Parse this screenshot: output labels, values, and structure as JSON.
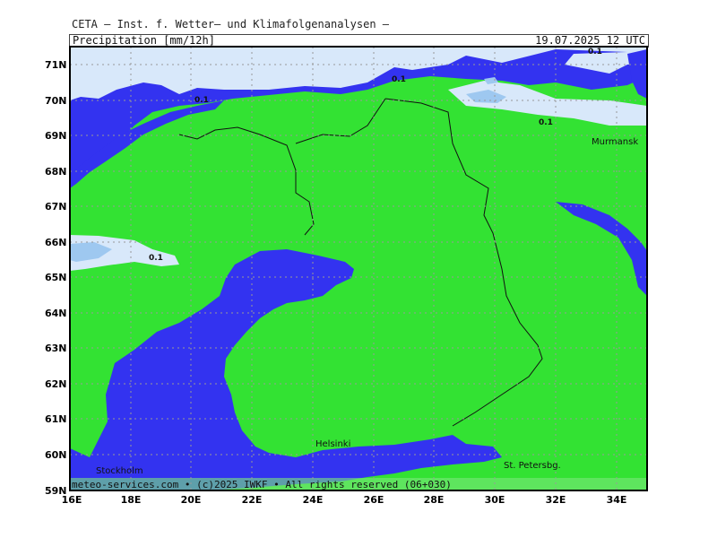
{
  "header": {
    "source": "CETA — Inst. f. Wetter— und Klimafolgenanalysen —",
    "variable": "Precipitation [mm/12h]",
    "timestamp": "19.07.2025 12 UTC"
  },
  "footer": {
    "copyright": "meteo-services.com • (c)2025 IWKF • All rights reserved (06+030)"
  },
  "map": {
    "colors": {
      "land_no_precip": "#33e233",
      "sea": "#3333f0",
      "precip_light": "#d8e8fa",
      "precip_medium": "#9ec8f0",
      "border": "#111111",
      "grid": "#999999"
    },
    "lat_labels": [
      "71N",
      "70N",
      "69N",
      "68N",
      "67N",
      "66N",
      "65N",
      "64N",
      "63N",
      "62N",
      "61N",
      "60N",
      "59N"
    ],
    "lon_labels": [
      "16E",
      "18E",
      "20E",
      "22E",
      "24E",
      "26E",
      "28E",
      "30E",
      "32E",
      "34E"
    ],
    "cities": [
      {
        "name": "Murmansk"
      },
      {
        "name": "Helsinki"
      },
      {
        "name": "Stockholm"
      },
      {
        "name": "St. Petersbg."
      }
    ],
    "contour_labels": [
      "0.1",
      "0.1",
      "0.1",
      "0.1",
      "0.1"
    ]
  }
}
